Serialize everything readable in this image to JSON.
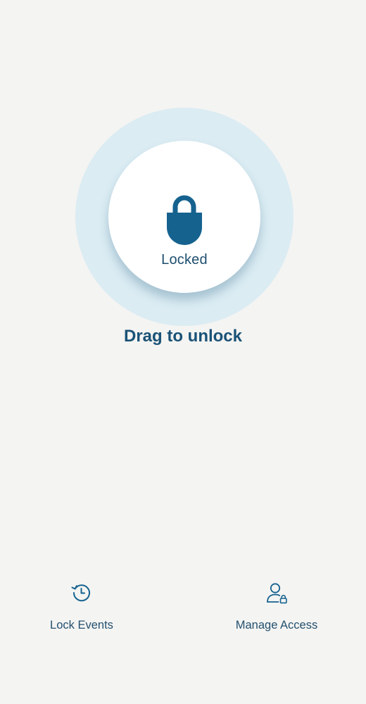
{
  "lock": {
    "status_label": "Locked",
    "icon": "padlock-closed-icon"
  },
  "hint": "Drag to unlock",
  "actions": [
    {
      "label": "Lock Events",
      "icon": "history-clock-icon"
    },
    {
      "label": "Manage Access",
      "icon": "user-lock-icon"
    }
  ],
  "colors": {
    "background": "#f4f4f2",
    "halo": "#dbecf3",
    "accent": "#15628f",
    "text": "#1b5277"
  }
}
